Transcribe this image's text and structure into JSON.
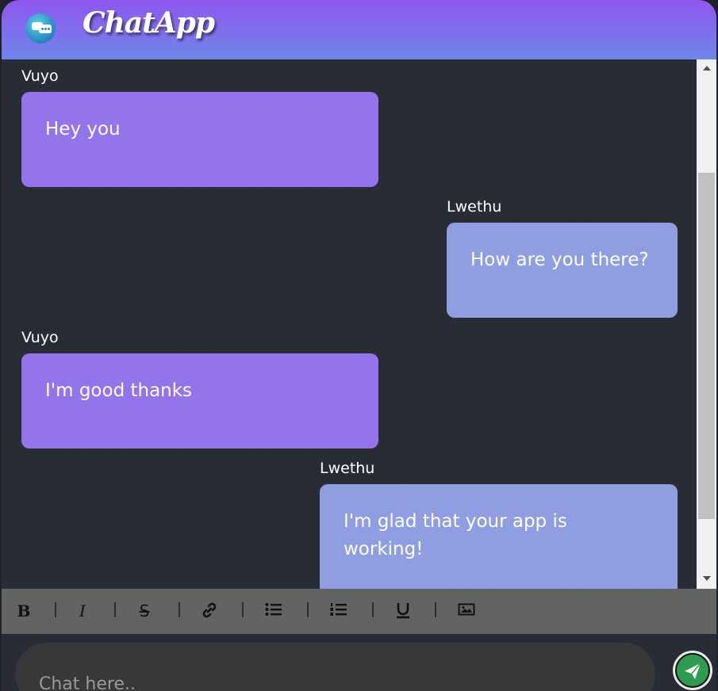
{
  "app": {
    "title": "ChatApp"
  },
  "messages": [
    {
      "sender": "Vuyo",
      "text": "Hey you",
      "side": "left"
    },
    {
      "sender": "Lwethu",
      "text": "How are you there?",
      "side": "right"
    },
    {
      "sender": "Vuyo",
      "text": "I'm good thanks",
      "side": "left"
    },
    {
      "sender": "Lwethu",
      "text": "I'm glad that your app is working!",
      "side": "right"
    }
  ],
  "toolbar": {
    "bold": "B",
    "italic": "I",
    "strike": "S",
    "icons": [
      "bold-icon",
      "italic-icon",
      "strikethrough-icon",
      "link-icon",
      "bullet-list-icon",
      "numbered-list-icon",
      "underline-icon",
      "image-icon"
    ]
  },
  "composer": {
    "placeholder": "Chat here..",
    "send_icon": "paper-plane-icon"
  },
  "colors": {
    "header_top": "#8f56ef",
    "header_bottom": "#6f86ea",
    "bubble_left": "#9474eb",
    "bubble_right": "#8e9ee0",
    "send": "#2e9a52",
    "background": "#272c35"
  }
}
